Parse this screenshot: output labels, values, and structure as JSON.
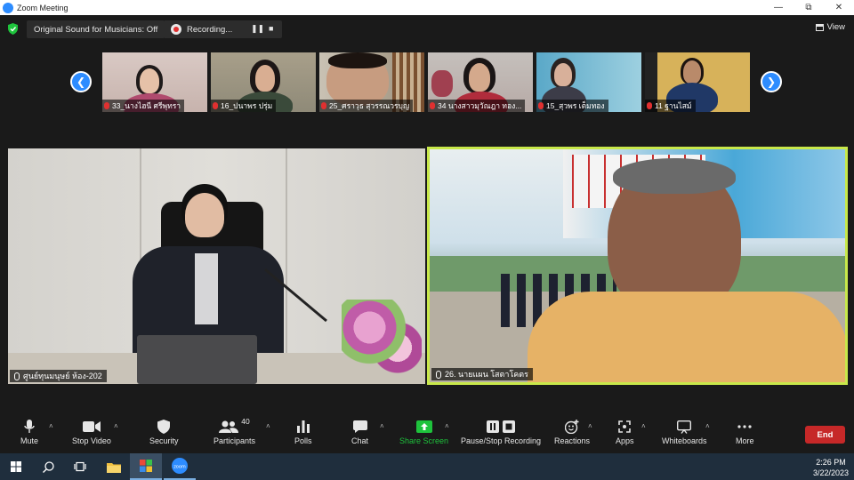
{
  "window": {
    "title": "Zoom Meeting"
  },
  "topbar": {
    "sound_label": "Original Sound for Musicians: Off",
    "recording_label": "Recording...",
    "view_label": "View"
  },
  "thumbnails": [
    {
      "name": "33_นางไฮนี  ศรีพุทรา"
    },
    {
      "name": "16_ปนาพร ปรุ่ม"
    },
    {
      "name": "25_ศราวุธ สุวรรณวรบุญ"
    },
    {
      "name": "34 นางสาวมุวัณฎา  ทอง..."
    },
    {
      "name": "15_สุวพร เต็มทอง"
    },
    {
      "name": "11 ฐานไสม์"
    }
  ],
  "tiles": [
    {
      "name": "ศูนย์ทุนมนุษย์ ห้อง-202"
    },
    {
      "name": "26. นายแผน  โสตาโคตร"
    }
  ],
  "toolbar": {
    "mute": "Mute",
    "stop_video": "Stop Video",
    "security": "Security",
    "participants": "Participants",
    "participants_count": "40",
    "polls": "Polls",
    "chat": "Chat",
    "share_screen": "Share Screen",
    "pause_recording": "Pause/Stop Recording",
    "reactions": "Reactions",
    "apps": "Apps",
    "whiteboards": "Whiteboards",
    "more": "More",
    "end": "End"
  },
  "taskbar": {
    "time": "2:26 PM",
    "date": "3/22/2023"
  },
  "colors": {
    "accent": "#2d8cff",
    "share": "#1ec33c",
    "end": "#c62828",
    "active_speaker": "#c8e84a"
  }
}
